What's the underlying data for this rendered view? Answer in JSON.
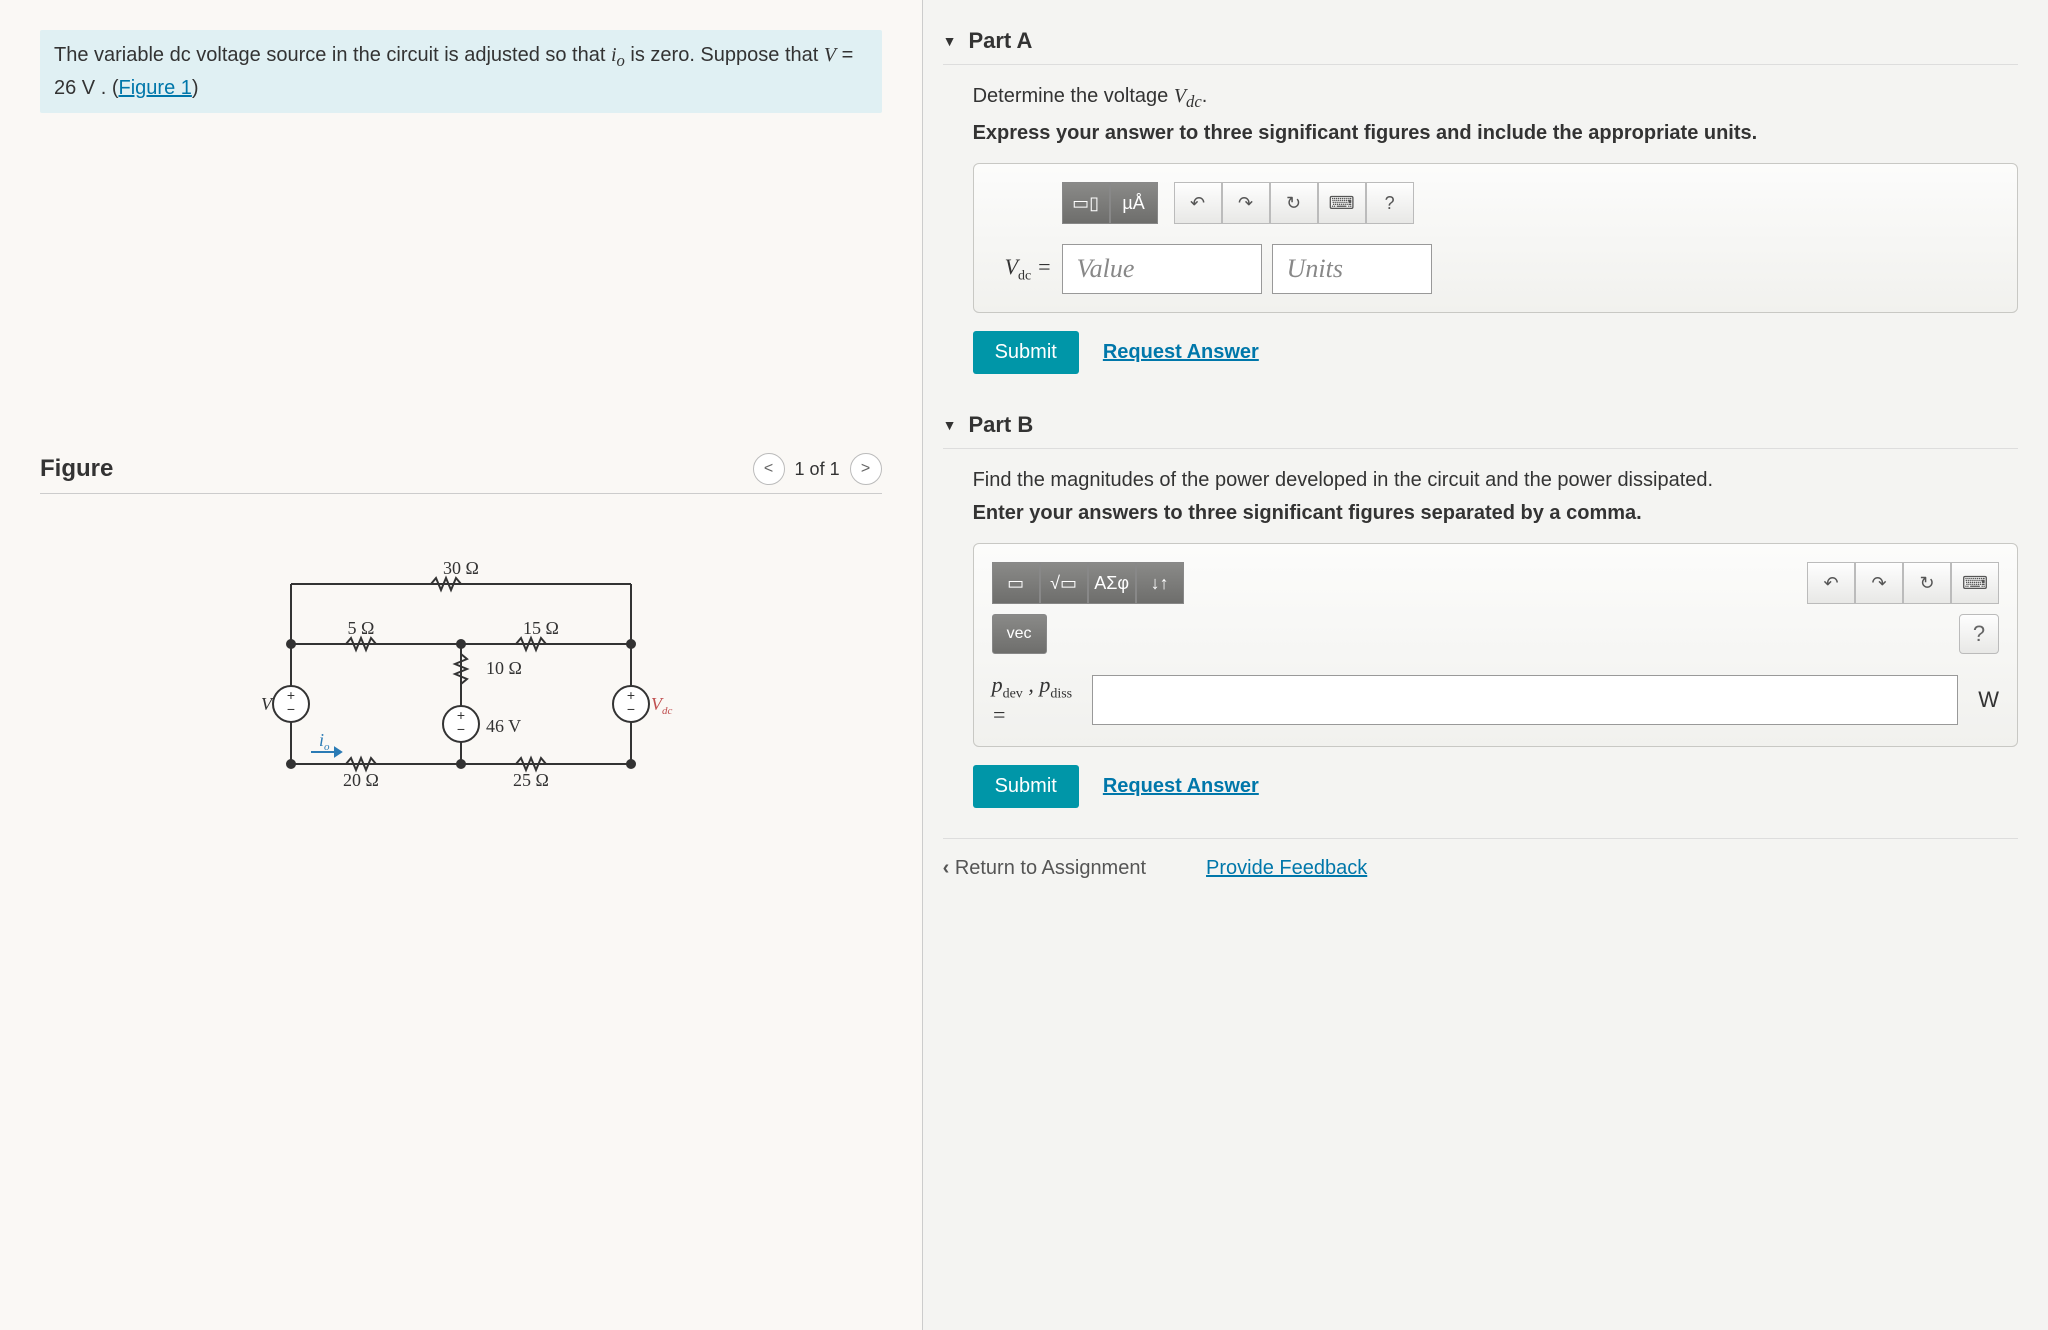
{
  "problem": {
    "text_before": "The variable dc voltage source in the circuit is adjusted so that ",
    "io_symbol": "i",
    "io_sub": "o",
    "text_mid": " is zero. Suppose that ",
    "V_symbol": "V",
    "V_value": " = 26  V",
    "text_after": " . (",
    "fig_link": "Figure 1",
    "close": ")"
  },
  "figure": {
    "title": "Figure",
    "nav_label": "1 of 1",
    "labels": {
      "r30": "30 Ω",
      "r5": "5 Ω",
      "r15": "15 Ω",
      "r10": "10 Ω",
      "v46": "46 V",
      "r20": "20 Ω",
      "r25": "25 Ω",
      "V": "V",
      "Vdc": "V",
      "Vdc_sub": "dc",
      "io": "i",
      "io_sub": "o"
    }
  },
  "partA": {
    "header": "Part A",
    "prompt_pre": "Determine the voltage ",
    "prompt_sym": "V",
    "prompt_sub": "dc",
    "prompt_post": ".",
    "instruction": "Express your answer to three significant figures and include the appropriate units.",
    "toolbar": {
      "templates": "▭▯",
      "units": "µÅ",
      "undo": "↶",
      "redo": "↷",
      "reset": "↻",
      "keyboard": "⌨",
      "help": "?"
    },
    "var": "V",
    "var_sub": "dc",
    "equals": " = ",
    "value_placeholder": "Value",
    "units_placeholder": "Units",
    "submit": "Submit",
    "request": "Request Answer"
  },
  "partB": {
    "header": "Part B",
    "prompt": "Find the magnitudes of the power developed in the circuit and the power dissipated.",
    "instruction": "Enter your answers to three significant figures separated by a comma.",
    "toolbar": {
      "fmt": "▭",
      "sqrt": "√▭",
      "greek": "ΑΣφ",
      "updown": "↓↑",
      "undo": "↶",
      "redo": "↷",
      "reset": "↻",
      "keyboard": "⌨"
    },
    "vec": "vec",
    "help": "?",
    "var_html": "p",
    "var_sub1": "dev",
    "var_sep": " , ",
    "var_sub2": "diss",
    "equals_line": "=",
    "unit": "W",
    "submit": "Submit",
    "request": "Request Answer"
  },
  "footer": {
    "return": "Return to Assignment",
    "feedback": "Provide Feedback"
  }
}
